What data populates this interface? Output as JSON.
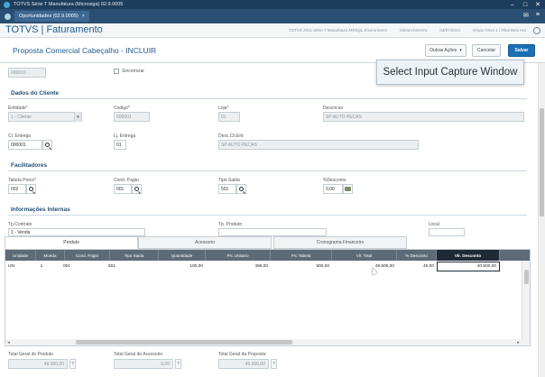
{
  "window": {
    "title": "TOTVS Série T Manufatura (Microsiga) 02.9.0005",
    "controls": [
      "–",
      "□",
      "✕"
    ]
  },
  "tabs": {
    "document_tab": "Oportunidades (02.9.0005)",
    "close_glyph": "×"
  },
  "header": {
    "app_title": "TOTVS | Faturamento",
    "env": [
      "TOTVS 2011 Série T Manufatura MSSQL Environment",
      "mbram.bezerra",
      "04/07/2014",
      "Grupo Totvs 1 / Filial Belo Hor"
    ]
  },
  "form": {
    "title": "Proposta Comercial Cabeçalho - INCLUIR",
    "more_actions": "Outras Ações",
    "cancel": "Cancelar",
    "save": "Salvar"
  },
  "tooltip": {
    "text": "Select Input Capture Window"
  },
  "top_fields": {
    "number_value": "000010",
    "sync_label": "Sincronizar"
  },
  "client": {
    "section": "Dados do Cliente",
    "entity_label": "Entidade",
    "entity_value": "1 - Cliente",
    "code_label": "Codigo",
    "code_value": "000001",
    "store_label": "Loja",
    "store_value": "01",
    "description_label": "Descricao",
    "description_value": "SP AUTO PECAS",
    "delivery_client_label": "Cl. Entrega",
    "delivery_client_value": "000001",
    "delivery_store_label": "Lj. Entrega",
    "delivery_store_value": "01",
    "delivery_desc_label": "Desc.Cli.Ent",
    "delivery_desc_value": "SP AUTO PECAS"
  },
  "facilitators": {
    "section": "Facilitadores",
    "price_table_label": "Tabela Preco",
    "price_table_value": "002",
    "payment_label": "Cond. Pagto",
    "payment_value": "001",
    "out_type_label": "Tipo Saida",
    "out_type_value": "501",
    "discount_label": "%Desconto",
    "discount_value": "0,00"
  },
  "internal": {
    "section": "Informações Internas",
    "contract_type_label": "Tp.Contrato",
    "contract_type_value": "1 - Venda",
    "product_type_label": "Tp. Produto",
    "location_label": "Local"
  },
  "grid_tabs": [
    "Produto",
    "Acessorio",
    "Cronograma Financeiro"
  ],
  "grid": {
    "columns": [
      "Unidade",
      "Moeda",
      "Cond. Pagto",
      "Tipo Saida",
      "Quantidade",
      "Prc Unitario",
      "Prc Tabela",
      "Vlr. Total",
      "% Desconto",
      "Vlr. Desconto"
    ],
    "rows": [
      [
        "UN",
        "1",
        "001",
        "501",
        "100,00",
        "495,00",
        "900,00",
        "49.500,00",
        "45,00",
        "40.500,00"
      ]
    ]
  },
  "totals": {
    "product_label": "Total Geral do Produto",
    "product_value": "49.500,00",
    "accessory_label": "Total Geral do Acessorio",
    "accessory_value": "0,00",
    "proposal_label": "Total Geral da Proposta",
    "proposal_value": "49.500,00"
  }
}
